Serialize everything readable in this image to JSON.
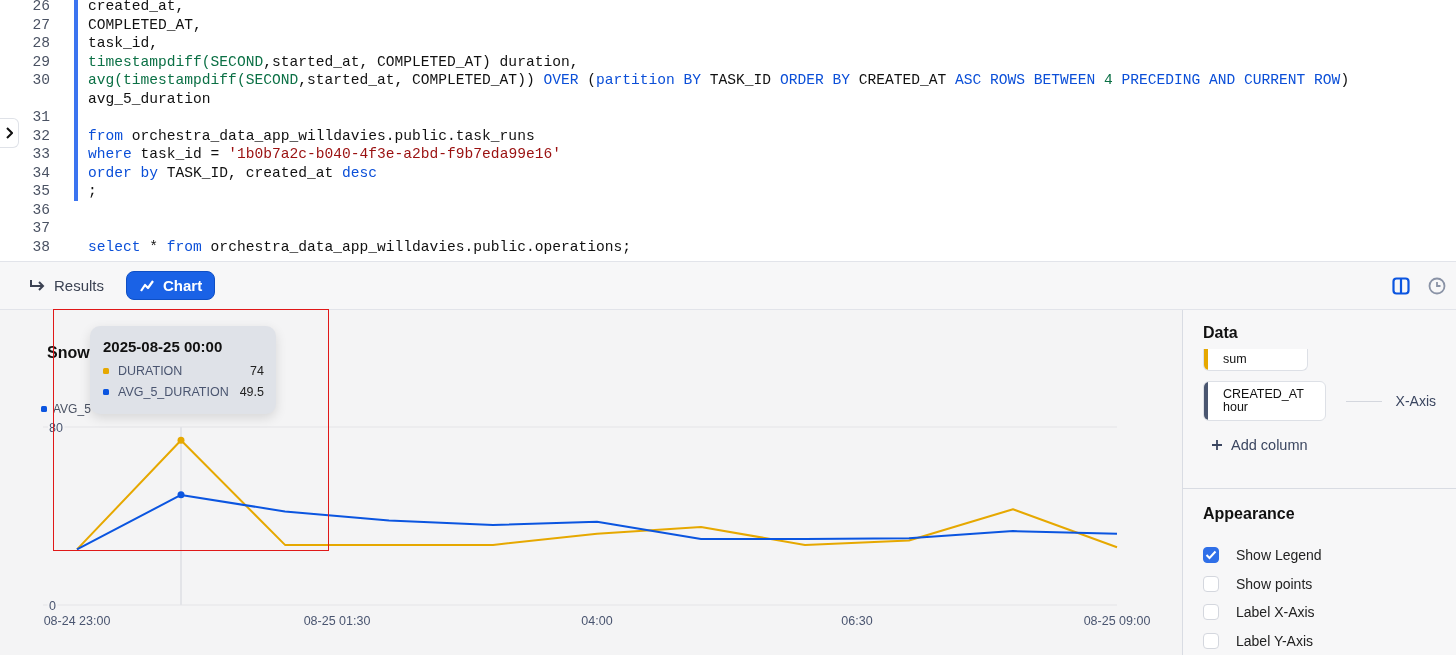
{
  "editor": {
    "lines": [
      {
        "number": "26",
        "modified": true,
        "tokens": [
          {
            "text": "created_at,",
            "kind": "plain"
          }
        ]
      },
      {
        "number": "27",
        "modified": true,
        "tokens": [
          {
            "text": "COMPLETED_AT,",
            "kind": "plain"
          }
        ]
      },
      {
        "number": "28",
        "modified": true,
        "tokens": [
          {
            "text": "task_id,",
            "kind": "plain"
          }
        ]
      },
      {
        "number": "29",
        "modified": true,
        "tokens": [
          {
            "text": "timestampdiff(SECOND",
            "kind": "fn"
          },
          {
            "text": ",started_at, COMPLETED_AT) duration,",
            "kind": "plain"
          }
        ]
      },
      {
        "number": "30",
        "modified": true,
        "tokens": [
          {
            "text": "avg(timestampdiff(SECOND",
            "kind": "fn"
          },
          {
            "text": ",started_at, COMPLETED_AT)) ",
            "kind": "plain"
          },
          {
            "text": "OVER",
            "kind": "kw"
          },
          {
            "text": " (",
            "kind": "plain"
          },
          {
            "text": "partition BY",
            "kind": "kw"
          },
          {
            "text": " TASK_ID ",
            "kind": "plain"
          },
          {
            "text": "ORDER BY",
            "kind": "kw"
          },
          {
            "text": " CREATED_AT ",
            "kind": "plain"
          },
          {
            "text": "ASC ROWS BETWEEN",
            "kind": "kw"
          },
          {
            "text": " 4 ",
            "kind": "num"
          },
          {
            "text": "PRECEDING AND CURRENT ROW",
            "kind": "kw"
          },
          {
            "text": ") avg_5_duration",
            "kind": "plain"
          }
        ]
      },
      {
        "number": "31",
        "modified": true
      },
      {
        "number": "32",
        "modified": true,
        "tokens": [
          {
            "text": "from",
            "kind": "kw"
          },
          {
            "text": " orchestra_data_app_willdavies.public.task_runs",
            "kind": "plain"
          }
        ]
      },
      {
        "number": "33",
        "modified": true,
        "tokens": [
          {
            "text": "where",
            "kind": "kw"
          },
          {
            "text": " task_id = ",
            "kind": "plain"
          },
          {
            "text": "'1b0b7a2c-b040-4f3e-a2bd-f9b7eda99e16'",
            "kind": "str"
          }
        ]
      },
      {
        "number": "34",
        "modified": true,
        "tokens": [
          {
            "text": "order by",
            "kind": "kw"
          },
          {
            "text": " TASK_ID, created_at ",
            "kind": "plain"
          },
          {
            "text": "desc",
            "kind": "kw"
          }
        ]
      },
      {
        "number": "35",
        "modified": true,
        "tokens": [
          {
            "text": ";",
            "kind": "plain"
          }
        ]
      },
      {
        "number": "36",
        "modified": false
      },
      {
        "number": "37",
        "modified": false
      },
      {
        "number": "38",
        "modified": false,
        "tokens": [
          {
            "text": "select",
            "kind": "kw"
          },
          {
            "text": " * ",
            "kind": "plain"
          },
          {
            "text": "from",
            "kind": "kw"
          },
          {
            "text": " orchestra_data_app_willdavies.public.operations;",
            "kind": "plain"
          }
        ]
      }
    ]
  },
  "result_tabs": [
    {
      "label": "Results",
      "selected": false
    },
    {
      "label": "Chart",
      "selected": true
    }
  ],
  "chart": {
    "title": "Snow",
    "legend": [
      {
        "label": "AVG_5",
        "color": "#0b55e0"
      }
    ],
    "tooltip": {
      "title": "2025-08-25 00:00",
      "values": [
        "74",
        "49.5"
      ]
    },
    "chart_data": {
      "type": "line",
      "categories": [
        "08-24 23:00",
        null,
        null,
        null,
        null,
        "08-25 01:30",
        null,
        null,
        null,
        null,
        "04:00",
        null,
        null,
        null,
        null,
        "06:30",
        null,
        null,
        null,
        null,
        "08-25 09:00"
      ],
      "series": [
        {
          "name": "DURATION",
          "color": "#e6a800",
          "values": [
            25,
            null,
            74,
            null,
            27,
            null,
            27,
            null,
            27,
            null,
            32,
            null,
            35,
            null,
            27,
            null,
            29,
            null,
            43,
            null,
            26
          ]
        },
        {
          "name": "AVG_5_DURATION",
          "color": "#0b55e0",
          "values": [
            25,
            null,
            49.5,
            null,
            42,
            null,
            38,
            null,
            36,
            null,
            37.4,
            null,
            29.6,
            null,
            29.6,
            null,
            30,
            null,
            33.2,
            null,
            32
          ]
        }
      ],
      "ylim": [
        0,
        80
      ],
      "yticks": [
        0,
        80
      ]
    }
  },
  "settings": {
    "data": {
      "heading": "Data",
      "columns": [
        {
          "label": "sum",
          "color": "#e6a800"
        },
        {
          "label": "CREATED_AT",
          "sublabel": "hour",
          "role": "X-Axis",
          "color": "#4a5670"
        }
      ],
      "add_label": "Add column"
    },
    "appearance": {
      "heading": "Appearance",
      "options": [
        {
          "label": "Show Legend",
          "checked": true
        },
        {
          "label": "Show points",
          "checked": false
        },
        {
          "label": "Label X-Axis",
          "checked": false
        },
        {
          "label": "Label Y-Axis",
          "checked": false
        }
      ]
    }
  }
}
